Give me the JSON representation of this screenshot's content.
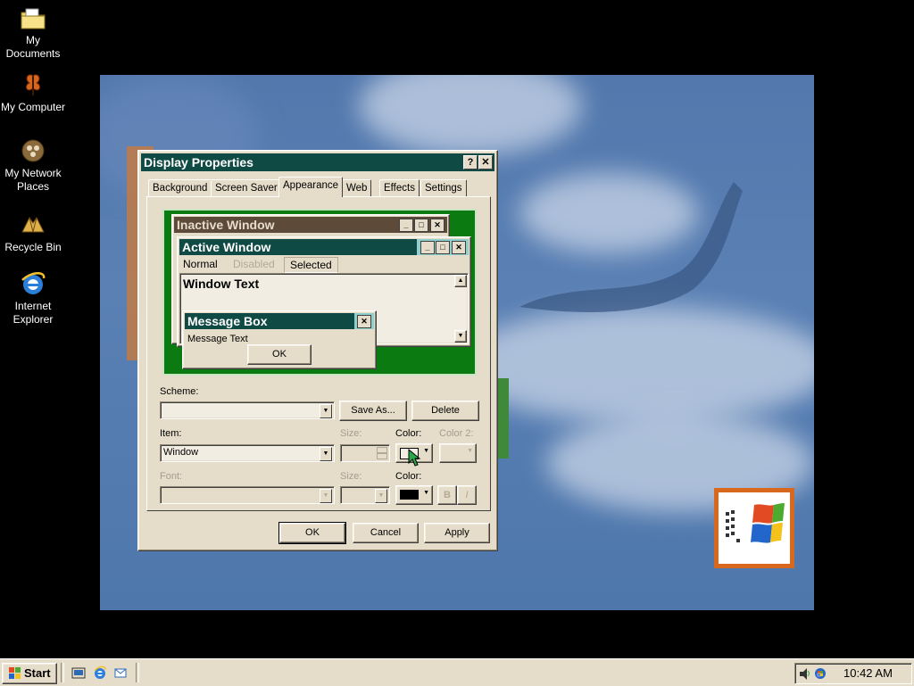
{
  "desktop": {
    "icons": [
      {
        "label": "My Documents",
        "icon": "folder-icon"
      },
      {
        "label": "My Computer",
        "icon": "computer-icon"
      },
      {
        "label": "My Network Places",
        "icon": "network-icon"
      },
      {
        "label": "Recycle Bin",
        "icon": "recycle-bin-icon"
      },
      {
        "label": "Internet Explorer",
        "icon": "ie-icon"
      }
    ]
  },
  "dialog": {
    "title": "Display Properties",
    "help_btn": "?",
    "close_btn": "✕",
    "tabs": [
      "Background",
      "Screen Saver",
      "Appearance",
      "Web",
      "Effects",
      "Settings"
    ],
    "active_tab": "Appearance",
    "preview": {
      "inactive_title": "Inactive Window",
      "active_title": "Active Window",
      "menu": [
        "Normal",
        "Disabled",
        "Selected"
      ],
      "window_text": "Window Text",
      "msgbox_title": "Message Box",
      "msgbox_text": "Message Text",
      "msgbox_ok": "OK"
    },
    "scheme_label": "Scheme:",
    "scheme_value": "",
    "save_as": "Save As...",
    "delete": "Delete",
    "item_label": "Item:",
    "item_value": "Window",
    "size_label": "Size:",
    "color_label": "Color:",
    "color2_label": "Color 2:",
    "font_label": "Font:",
    "font_size_label": "Size:",
    "font_color_label": "Color:",
    "bold_btn": "B",
    "italic_btn": "I",
    "ok": "OK",
    "cancel": "Cancel",
    "apply": "Apply"
  },
  "taskbar": {
    "start": "Start",
    "clock": "10:42 AM"
  },
  "colors": {
    "title_active": "#104a44",
    "title_inactive": "#5e4a39",
    "face": "#e5dcc9",
    "preview_bg": "#0b7a10",
    "wallpaper": "#5278ad"
  }
}
